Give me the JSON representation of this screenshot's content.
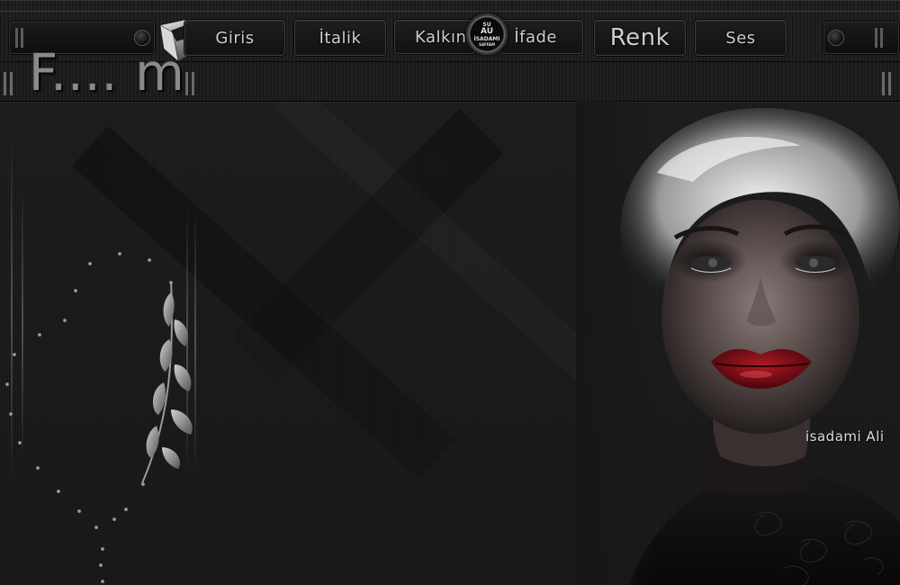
{
  "nav": {
    "buttons": [
      {
        "label": "Giris"
      },
      {
        "label": "İtalik"
      },
      {
        "label": "Kalkın"
      },
      {
        "label": "İfade"
      },
      {
        "label": "Renk"
      },
      {
        "label": "Ses"
      }
    ]
  },
  "emblem": {
    "line1": "SU",
    "line2": "AU",
    "line3": "İSADAMI",
    "line4": "SAYFAM"
  },
  "header": {
    "title": "F.... m"
  },
  "signature": "isadami Ali",
  "colors": {
    "background": "#171717",
    "nav_text": "#cfcfcf",
    "lips": "#7a0a12",
    "hair": "#e6e6e6"
  }
}
